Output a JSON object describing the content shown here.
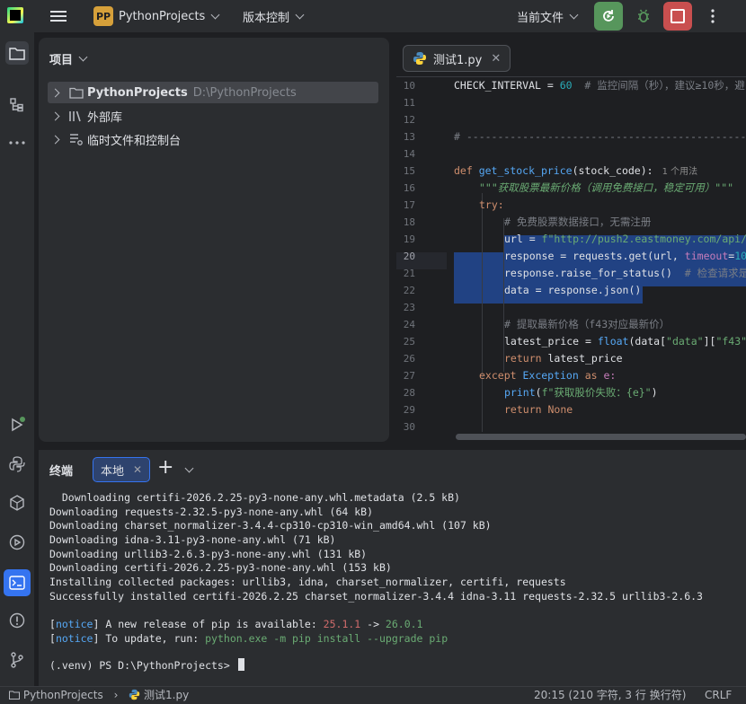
{
  "titlebar": {
    "project_badge": "PP",
    "project_name": "PythonProjects",
    "vcs_label": "版本控制",
    "run_config": "当前文件",
    "colors": {
      "run": "#57965c",
      "stop": "#c94f4f",
      "badge": "#d6a03a"
    }
  },
  "leftbar": {
    "icons": [
      "project-icon",
      "structure-icon",
      "more-icon",
      "run-icon",
      "python-packages-icon",
      "python-console-icon",
      "services-icon",
      "terminal-icon",
      "problems-icon",
      "git-icon"
    ]
  },
  "project_panel": {
    "title": "项目",
    "items": [
      {
        "label": "PythonProjects",
        "path": "D:\\PythonProjects"
      },
      {
        "label": "外部库"
      },
      {
        "label": "临时文件和控制台"
      }
    ]
  },
  "editor": {
    "tab_label": "测试1.py",
    "line_numbers": [
      "10",
      "11",
      "12",
      "13",
      "14",
      "15",
      "16",
      "17",
      "18",
      "19",
      "20",
      "21",
      "22",
      "23",
      "24",
      "25",
      "26",
      "27",
      "28",
      "29",
      "30"
    ],
    "current_line": "20",
    "code": {
      "l10_a": "CHECK_INTERVAL = ",
      "l10_num": "60",
      "l10_cm": "  # 监控间隔（秒），建议≥10秒，避",
      "l13": "# ------------------------------------------------",
      "l15_def": "def ",
      "l15_fn": "get_stock_price",
      "l15_rest": "(stock_code):",
      "l15_hint": "1 个用法",
      "l16": "\"\"\"获取股票最新价格（调用免费接口，稳定可用）\"\"\"",
      "l17": "try:",
      "l18": "# 免费股票数据接口，无需注册",
      "l19_a": "url = ",
      "l19_str": "f\"http://push2.eastmoney.com/api/",
      "l20_a": "response = requests.get(url, ",
      "l20_param": "timeout",
      "l20_b": "=",
      "l20_num": "10",
      "l21_a": "response.raise_for_status()",
      "l21_cm": "  # 检查请求是",
      "l22": "data = response.json()",
      "l24": "# 提取最新价格（f43对应最新价）",
      "l25_a": "latest_price = ",
      "l25_fn": "float",
      "l25_b": "(data[",
      "l25_s1": "\"data\"",
      "l25_c": "][",
      "l25_s2": "\"f43\"",
      "l26_kw": "return ",
      "l26_b": "latest_price",
      "l27_kw": "except ",
      "l27_b": "Exception",
      "l27_kw2": " as ",
      "l27_c": "e:",
      "l28_fn": "print",
      "l28_b": "(",
      "l28_str": "f\"获取股价失败：{e}\"",
      "l28_c": ")",
      "l29_kw": "return ",
      "l29_b": "None"
    }
  },
  "terminal": {
    "title": "终端",
    "tab_label": "本地",
    "lines": [
      "  Downloading certifi-2026.2.25-py3-none-any.whl.metadata (2.5 kB)",
      "Downloading requests-2.32.5-py3-none-any.whl (64 kB)",
      "Downloading charset_normalizer-3.4.4-cp310-cp310-win_amd64.whl (107 kB)",
      "Downloading idna-3.11-py3-none-any.whl (71 kB)",
      "Downloading urllib3-2.6.3-py3-none-any.whl (131 kB)",
      "Downloading certifi-2026.2.25-py3-none-any.whl (153 kB)",
      "Installing collected packages: urllib3, idna, charset_normalizer, certifi, requests",
      "Successfully installed certifi-2026.2.25 charset_normalizer-3.4.4 idna-3.11 requests-2.32.5 urllib3-2.6.3"
    ],
    "notice1": {
      "tag": "notice",
      "text": " A new release of pip is available: ",
      "old": "25.1.1",
      "arrow": " -> ",
      "new": "26.0.1"
    },
    "notice2": {
      "tag": "notice",
      "text": " To update, run: ",
      "cmd": "python.exe -m pip install --upgrade pip"
    },
    "prompt": "(.venv) PS D:\\PythonProjects>"
  },
  "statusbar": {
    "project": "PythonProjects",
    "sep": "›",
    "file": "测试1.py",
    "position": "20:15 (210 字符, 3 行 换行符)",
    "line_ending": "CRLF"
  }
}
